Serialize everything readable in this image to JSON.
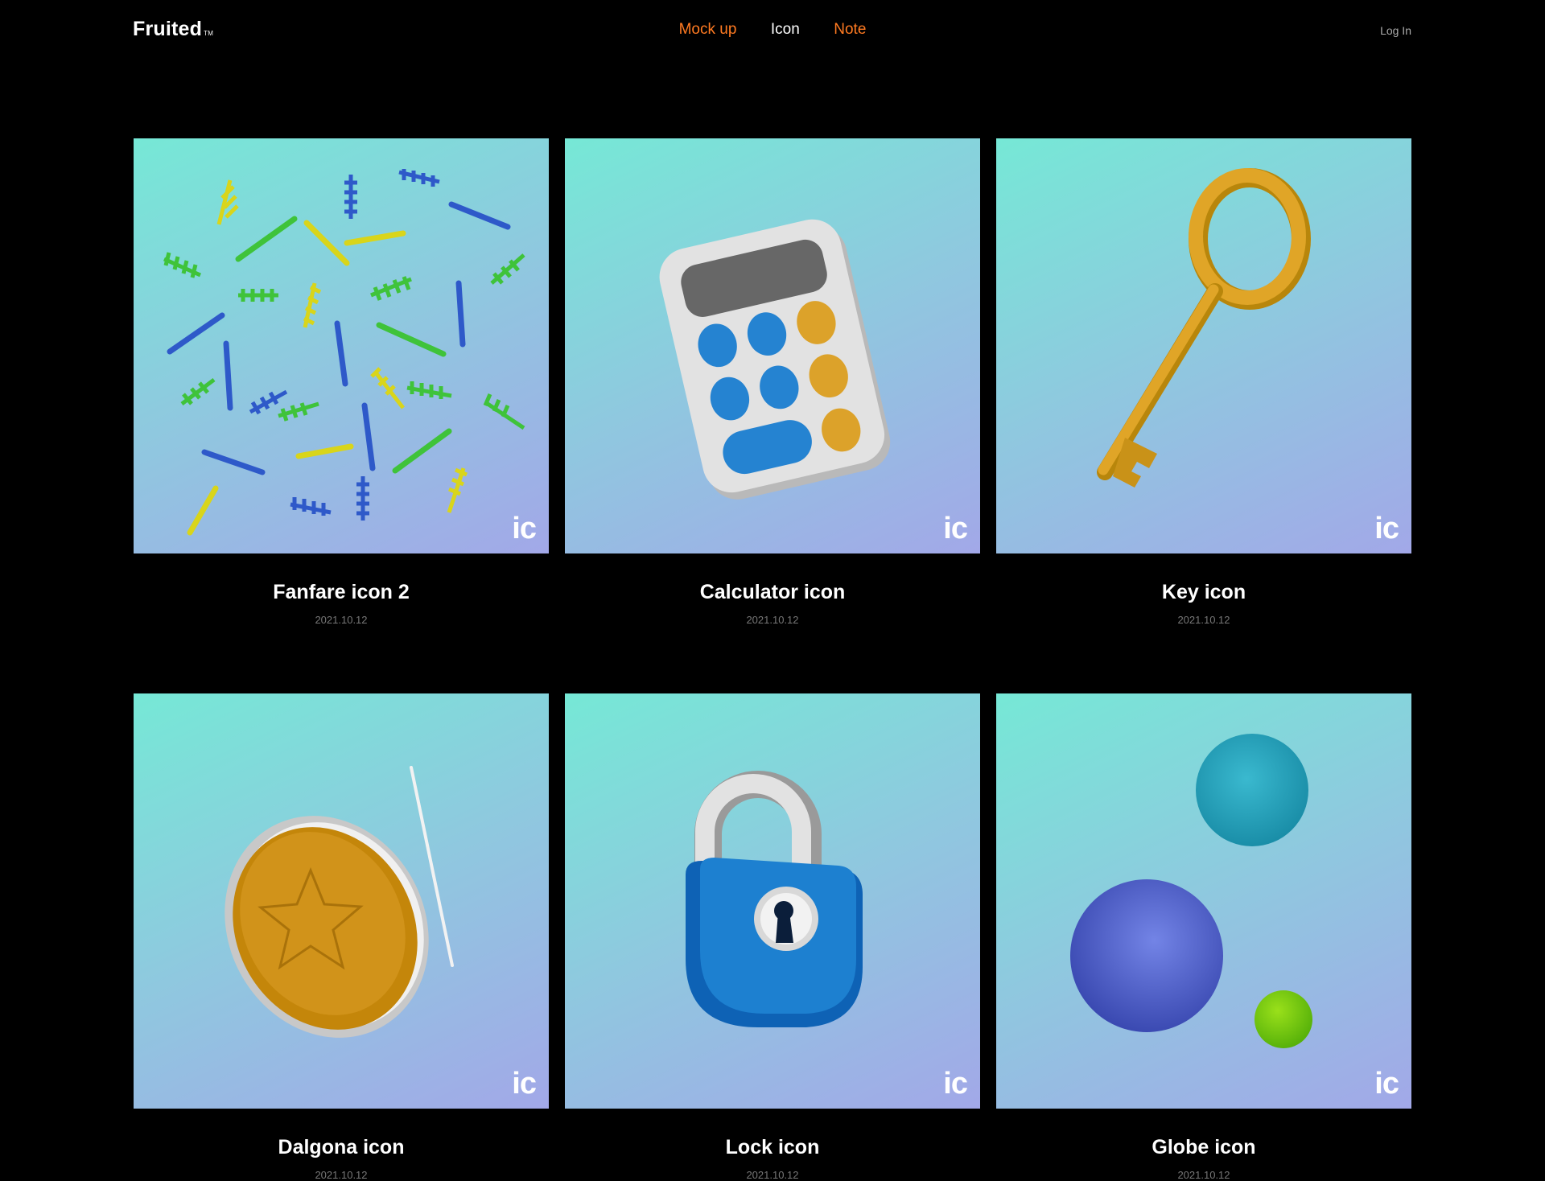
{
  "header": {
    "logo": "Fruited",
    "logo_tm": "TM",
    "nav": [
      {
        "label": "Mock up",
        "color": "#ff7a21"
      },
      {
        "label": "Icon",
        "color": "#ffffff"
      },
      {
        "label": "Note",
        "color": "#ff7a21"
      }
    ],
    "login": "Log In"
  },
  "cards": [
    {
      "title": "Fanfare icon 2",
      "date": "2021.10.12",
      "badge": "ic",
      "icon": "fanfare-icon"
    },
    {
      "title": "Calculator icon",
      "date": "2021.10.12",
      "badge": "ic",
      "icon": "calculator-icon"
    },
    {
      "title": "Key icon",
      "date": "2021.10.12",
      "badge": "ic",
      "icon": "key-icon"
    },
    {
      "title": "Dalgona icon",
      "date": "2021.10.12",
      "badge": "ic",
      "icon": "dalgona-icon"
    },
    {
      "title": "Lock icon",
      "date": "2021.10.12",
      "badge": "ic",
      "icon": "lock-icon"
    },
    {
      "title": "Globe icon",
      "date": "2021.10.12",
      "badge": "ic",
      "icon": "globe-icon"
    }
  ]
}
